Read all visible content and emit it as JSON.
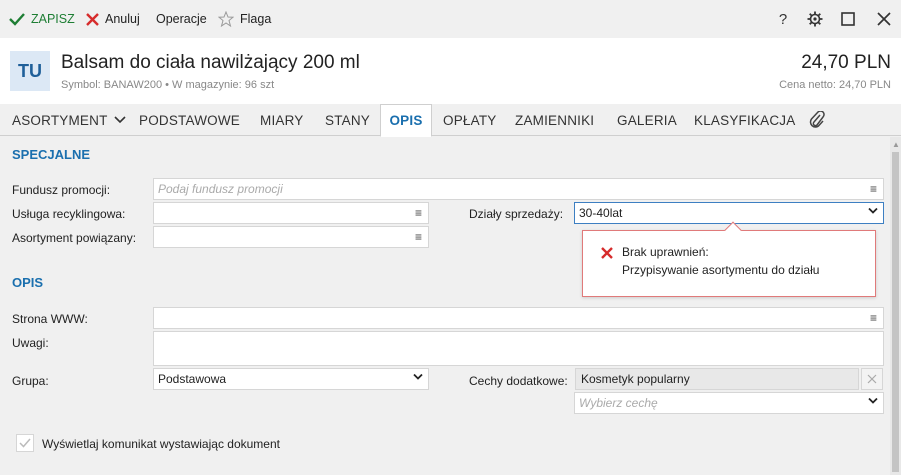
{
  "toolbar": {
    "save_label": "ZAPISZ",
    "cancel_label": "Anuluj",
    "operations_label": "Operacje",
    "flag_label": "Flaga",
    "help_label": "?"
  },
  "header": {
    "avatar": "TU",
    "title": "Balsam do ciała nawilżający 200 ml",
    "subtitle": "Symbol: BANAW200  •  W magazynie: 96 szt",
    "price": "24,70 PLN",
    "net_price": "Cena netto: 24,70 PLN"
  },
  "tabs": [
    {
      "label": "ASORTYMENT"
    },
    {
      "label": "PODSTAWOWE"
    },
    {
      "label": "MIARY"
    },
    {
      "label": "STANY"
    },
    {
      "label": "OPIS"
    },
    {
      "label": "OPŁATY"
    },
    {
      "label": "ZAMIENNIKI"
    },
    {
      "label": "GALERIA"
    },
    {
      "label": "KLASYFIKACJA"
    }
  ],
  "special": {
    "heading": "SPECJALNE",
    "promo_label": "Fundusz promocji:",
    "promo_placeholder": "Podaj fundusz promocji",
    "recycling_label": "Usługa recyklingowa:",
    "recycling_value": "",
    "related_label": "Asortyment powiązany:",
    "related_value": "",
    "sales_dept_label": "Działy sprzedaży:",
    "sales_dept_value": "30-40lat"
  },
  "error": {
    "title": "Brak uprawnień:",
    "message": "Przypisywanie asortymentu do działu"
  },
  "description": {
    "heading": "OPIS",
    "www_label": "Strona WWW:",
    "www_value": "",
    "notes_label": "Uwagi:",
    "notes_value": "",
    "group_label": "Grupa:",
    "group_value": "Podstawowa",
    "features_label": "Cechy dodatkowe:",
    "feature_chip": "Kosmetyk popularny",
    "feature_placeholder": "Wybierz cechę",
    "show_message_label": "Wyświetlaj komunikat wystawiając dokument"
  },
  "colors": {
    "accent": "#1a6fae",
    "save_green": "#1e7e34",
    "cancel_red": "#d62c2c",
    "error_border": "#e07a7a"
  }
}
